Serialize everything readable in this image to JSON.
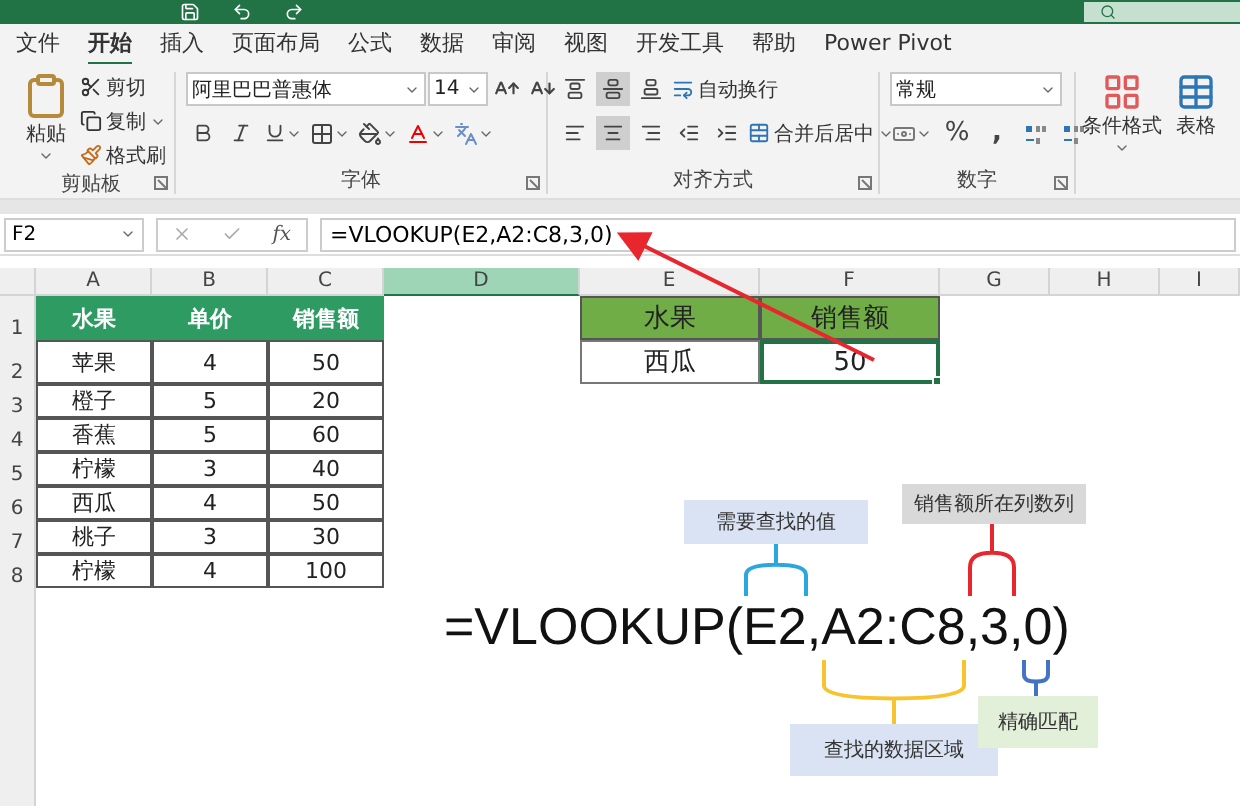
{
  "tabs": [
    {
      "label": "文件",
      "selected": false
    },
    {
      "label": "开始",
      "selected": true
    },
    {
      "label": "插入",
      "selected": false
    },
    {
      "label": "页面布局",
      "selected": false
    },
    {
      "label": "公式",
      "selected": false
    },
    {
      "label": "数据",
      "selected": false
    },
    {
      "label": "审阅",
      "selected": false
    },
    {
      "label": "视图",
      "selected": false
    },
    {
      "label": "开发工具",
      "selected": false
    },
    {
      "label": "帮助",
      "selected": false
    },
    {
      "label": "Power Pivot",
      "selected": false
    }
  ],
  "clipboard": {
    "paste": "粘贴",
    "cut": "剪切",
    "copy": "复制",
    "format_painter": "格式刷",
    "label": "剪贴板"
  },
  "font": {
    "name": "阿里巴巴普惠体",
    "size": "14",
    "label": "字体"
  },
  "alignment": {
    "vertical": [
      {
        "selected": false
      },
      {
        "selected": true
      },
      {
        "selected": false
      }
    ],
    "horizontal": [
      {
        "selected": false
      },
      {
        "selected": true
      },
      {
        "selected": false
      }
    ],
    "wrap": "自动换行",
    "merge": "合并后居中",
    "label": "对齐方式"
  },
  "number": {
    "format": "常规",
    "percent": "%",
    "comma": ",",
    "label": "数字"
  },
  "styles": {
    "conditional": "条件格式",
    "table": "表格"
  },
  "name_box": "F2",
  "fx": "fx",
  "formula": "=VLOOKUP(E2,A2:C8,3,0)",
  "columns": [
    {
      "label": "A",
      "selected": false
    },
    {
      "label": "B",
      "selected": false
    },
    {
      "label": "C",
      "selected": false
    },
    {
      "label": "D",
      "selected": true
    },
    {
      "label": "E",
      "selected": false
    },
    {
      "label": "F",
      "selected": false
    },
    {
      "label": "G",
      "selected": false
    },
    {
      "label": "H",
      "selected": false
    },
    {
      "label": "I",
      "selected": false
    }
  ],
  "row_headers": [
    "1",
    "2",
    "3",
    "4",
    "5",
    "6",
    "7",
    "8"
  ],
  "fruit_table": {
    "header": [
      "水果",
      "单价",
      "销售额"
    ],
    "rows": [
      [
        "苹果",
        "4",
        "50"
      ],
      [
        "橙子",
        "5",
        "20"
      ],
      [
        "香蕉",
        "5",
        "60"
      ],
      [
        "柠檬",
        "3",
        "40"
      ],
      [
        "西瓜",
        "4",
        "50"
      ],
      [
        "桃子",
        "3",
        "30"
      ],
      [
        "柠檬",
        "4",
        "100"
      ]
    ]
  },
  "lookup_table": {
    "header": [
      "水果",
      "销售额"
    ],
    "row": [
      {
        "text": "西瓜",
        "selected": false
      },
      {
        "text": "50",
        "selected": true
      }
    ]
  },
  "annotation": {
    "formula": "=VLOOKUP(E2,A2:C8,3,0)",
    "callouts": [
      {
        "kind": "value",
        "text": "需要查找的值",
        "color": "#2aa7df"
      },
      {
        "kind": "column",
        "text": "销售额所在列数列",
        "color": "#e8262d"
      },
      {
        "kind": "range",
        "text": "查找的数据区域",
        "color": "#f7c32e"
      },
      {
        "kind": "match",
        "text": "精确匹配",
        "color": "#4472c4"
      }
    ]
  }
}
